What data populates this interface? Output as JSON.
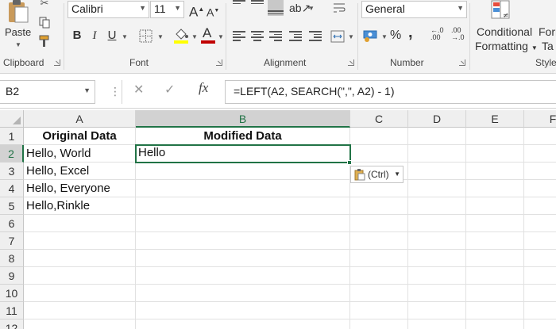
{
  "ribbon": {
    "clipboard": {
      "label": "Clipboard",
      "paste_label": "Paste"
    },
    "font": {
      "label": "Font",
      "name": "Calibri",
      "size": "11",
      "bold": "B",
      "italic": "I",
      "underline": "U",
      "grow": "A",
      "shrink": "A",
      "font_color_letter": "A"
    },
    "alignment": {
      "label": "Alignment"
    },
    "number": {
      "label": "Number",
      "format": "General",
      "currency": "$",
      "percent": "%",
      "comma": ",",
      "inc_decimal": "←.0\n.00",
      "dec_decimal": ".00\n→.0"
    },
    "styles": {
      "cond_line1": "Conditional",
      "cond_line2": "Formatting",
      "format_as_line1": "Form",
      "format_as_line2": "Ta",
      "styles_label": "Style"
    }
  },
  "formula_bar": {
    "name_box": "B2",
    "cancel": "✕",
    "enter": "✓",
    "fx": "fx",
    "formula": "=LEFT(A2, SEARCH(\",\", A2) - 1)"
  },
  "sheet": {
    "columns": [
      "A",
      "B",
      "C",
      "D",
      "E",
      "F"
    ],
    "rows": [
      "1",
      "2",
      "3",
      "4",
      "5",
      "6",
      "7",
      "8",
      "9",
      "10",
      "11",
      "12"
    ],
    "selected_cell": "B2",
    "cells": {
      "A1": "Original Data",
      "B1": "Modified Data",
      "A2": "Hello, World",
      "B2": "Hello",
      "A3": "Hello, Excel",
      "A4": "Hello, Everyone",
      "A5": "Hello,Rinkle"
    },
    "paste_options_label": "(Ctrl)"
  },
  "colors": {
    "accent": "#217346",
    "font_color_bar": "#c00000",
    "highlight_bar": "#ffff00"
  },
  "icons": [
    "paste-icon",
    "cut-icon",
    "copy-icon",
    "format-painter-icon",
    "borders-icon",
    "fill-color-icon",
    "font-color-icon",
    "wrap-text-icon",
    "merge-center-icon",
    "orientation-icon",
    "currency-icon",
    "conditional-formatting-icon",
    "paste-options-icon"
  ]
}
